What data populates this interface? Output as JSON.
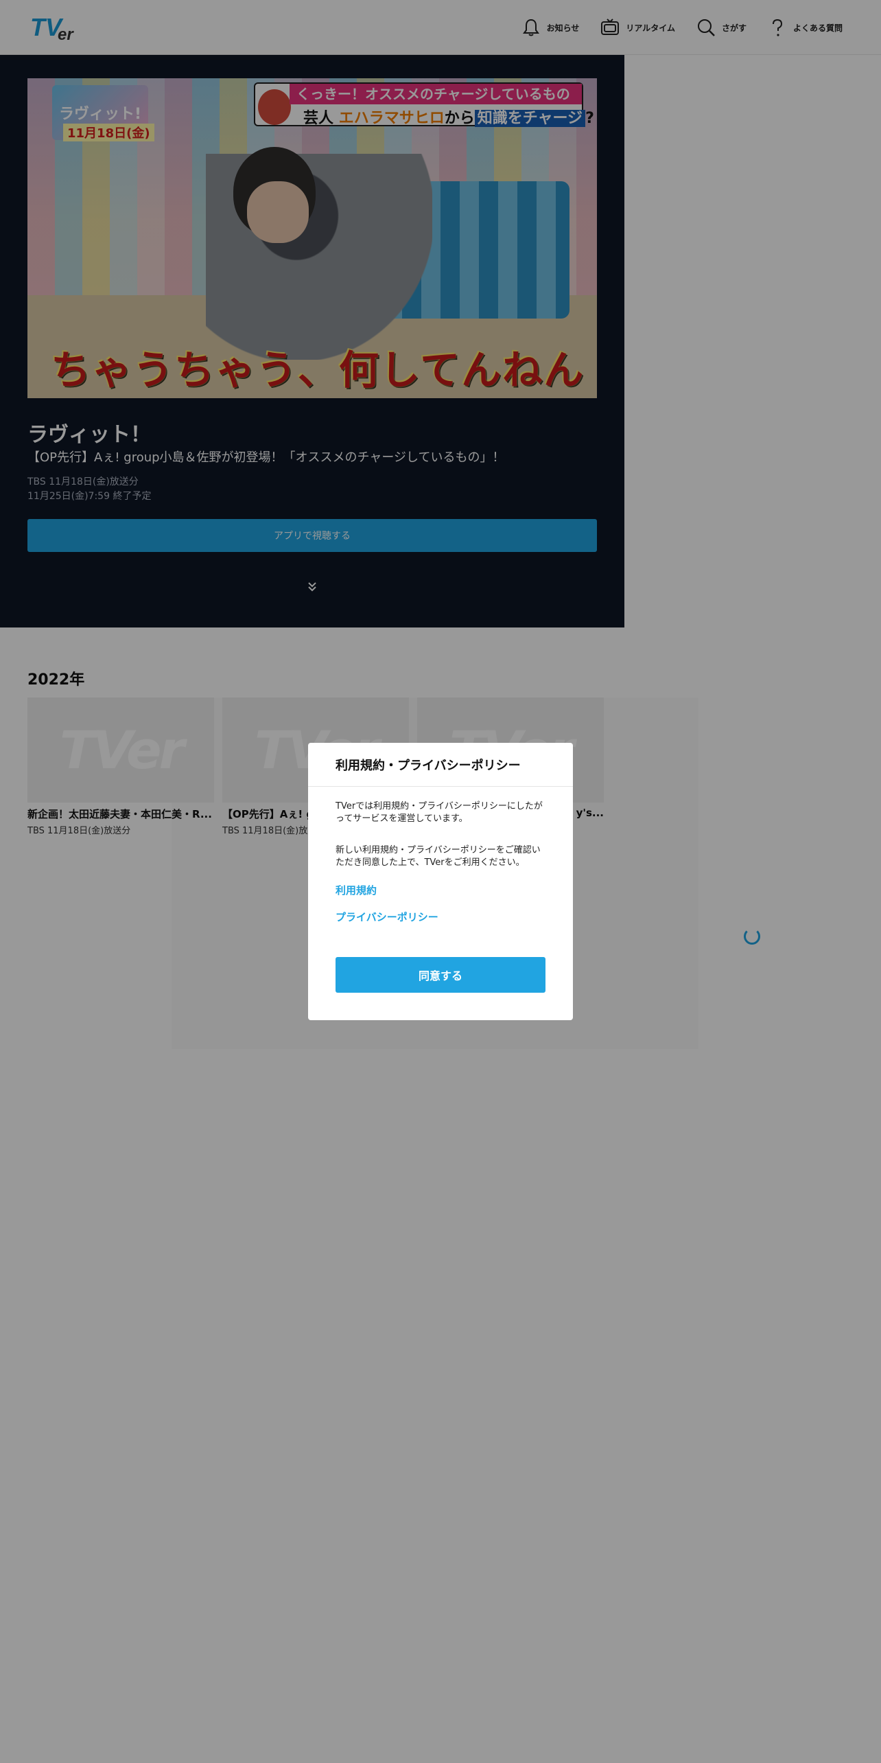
{
  "header": {
    "logo_text": "TVer",
    "nav": [
      {
        "label": "お知らせ",
        "icon": "bell-icon"
      },
      {
        "label": "リアルタイム",
        "icon": "tv-icon"
      },
      {
        "label": "さがす",
        "icon": "search-icon"
      },
      {
        "label": "よくある質問",
        "icon": "question-icon"
      }
    ]
  },
  "hero": {
    "thumbnail": {
      "corner_logo": "ラヴィット!",
      "date_tag": "11月18日(金)",
      "banner_line1": "くっきー！オススメのチャージしているもの",
      "banner_line2_a": "芸人",
      "banner_line2_b": "エハラマサヒロ",
      "banner_line2_c": "から",
      "banner_line2_d": "知識をチャージ",
      "banner_line2_e": "?",
      "caption": "ちゃうちゃう、何してんねん"
    },
    "title": "ラヴィット！",
    "subtitle": "【OP先行】Aぇ! group小島＆佐野が初登場！「オススメのチャージしているもの」！",
    "broadcast": "TBS 11月18日(金)放送分",
    "expires": "11月25日(金)7:59 終了予定",
    "watch_button": "アプリで視聴する"
  },
  "section": {
    "title": "2022年",
    "cards": [
      {
        "title": "新企画！太田近藤夫妻・本田仁美・R...",
        "meta": "TBS 11月18日(金)放送分",
        "logo": "TVer"
      },
      {
        "title": "【OP先行】Aぇ! g",
        "meta": "TBS 11月18日(金)放送",
        "logo": "TVer"
      },
      {
        "title": "y's...",
        "meta": "",
        "logo": "TVer"
      }
    ]
  },
  "modal": {
    "title": "利用規約・プライバシーポリシー",
    "text1": "TVerでは利用規約・プライバシーポリシーにしたがってサービスを運営しています。",
    "text2": "新しい利用規約・プライバシーポリシーをご確認いただき同意した上で、TVerをご利用ください。",
    "link_terms": "利用規約",
    "link_privacy": "プライバシーポリシー",
    "agree_button": "同意する"
  },
  "colors": {
    "accent": "#21a4e1",
    "hero_bg": "#0e1626",
    "overlay": "rgba(0,0,0,0.4)"
  }
}
